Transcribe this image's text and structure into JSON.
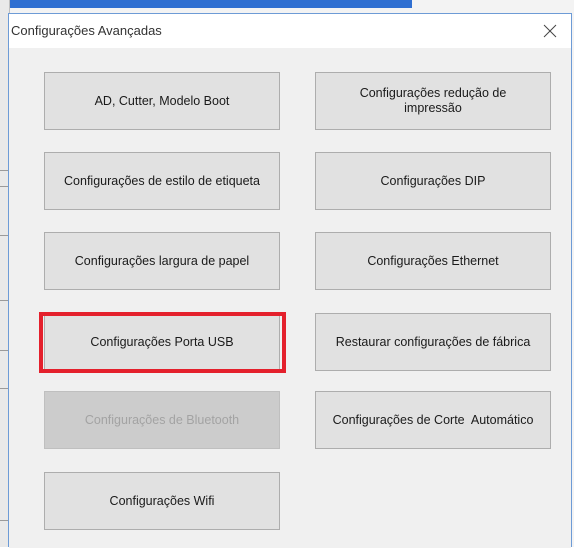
{
  "window": {
    "title": "Configurações Avançadas",
    "close_glyph": "✕"
  },
  "buttons": {
    "ad_cutter": "AD, Cutter, Modelo Boot",
    "print_reduction": "Configurações redução de impressão",
    "label_style": "Configurações de estilo de etiqueta",
    "dip": "Configurações DIP",
    "paper_width": "Configurações largura de papel",
    "ethernet": "Configurações Ethernet",
    "usb_port": "Configurações Porta USB",
    "factory_reset": "Restaurar configurações de fábrica",
    "bluetooth": "Configurações de Bluetooth",
    "auto_cut": "Configurações de Corte  Automático",
    "wifi": "Configurações Wifi"
  },
  "states": {
    "bluetooth_enabled": false,
    "usb_port_highlighted": true
  },
  "colors": {
    "highlight": "#e4202c",
    "accent": "#2f6fd1",
    "disabled_text": "#a3a3a3"
  }
}
